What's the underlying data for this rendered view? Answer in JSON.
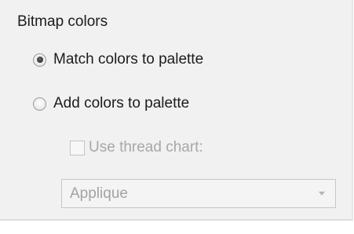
{
  "group": {
    "title": "Bitmap colors"
  },
  "options": [
    {
      "label": "Match colors to palette",
      "selected": true
    },
    {
      "label": "Add colors to palette",
      "selected": false
    }
  ],
  "thread_chart": {
    "label": "Use thread chart:",
    "checked": false,
    "enabled": false
  },
  "chart_select": {
    "value": "Applique",
    "enabled": false
  }
}
